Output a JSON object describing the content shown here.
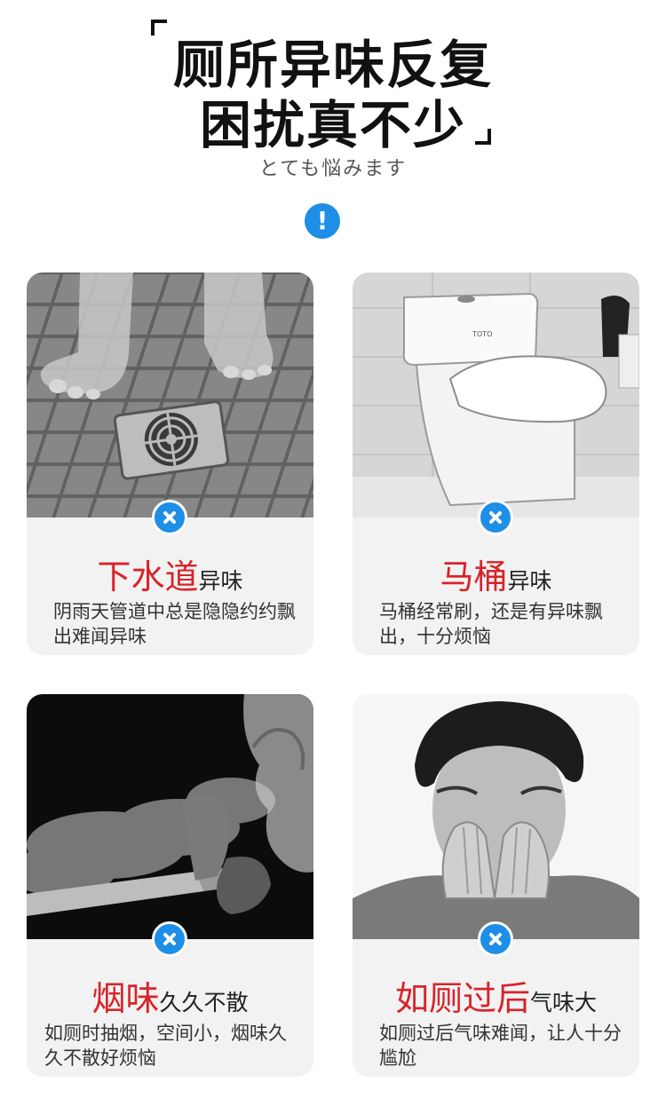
{
  "header": {
    "line1": "厕所异味反复",
    "line2": "困扰真不少",
    "subtitle": "とても悩みます"
  },
  "alert_symbol": "!",
  "cards": [
    {
      "title_red": "下水道",
      "title_black": "异味",
      "desc": "阴雨天管道中总是隐隐约约飘出难闻异味",
      "photo": "floor-drain-photo"
    },
    {
      "title_red": "马桶",
      "title_black": "异味",
      "desc": "马桶经常刷，还是有异味飘出，十分烦恼",
      "photo": "toilet-photo",
      "brand": "TOTO"
    },
    {
      "title_red": "烟味",
      "title_black": "久久不散",
      "desc": "如厕时抽烟，空间小，烟味久久不散好烦恼",
      "photo": "smoking-photo"
    },
    {
      "title_red": "如厕过后",
      "title_black": "气味大",
      "desc": "如厕过后气味难闻，让人十分尴尬",
      "photo": "man-covering-nose-photo"
    }
  ],
  "colors": {
    "accent_blue": "#1e8ee6",
    "title_red": "#d8232a",
    "card_bg": "#f2f2f2"
  }
}
